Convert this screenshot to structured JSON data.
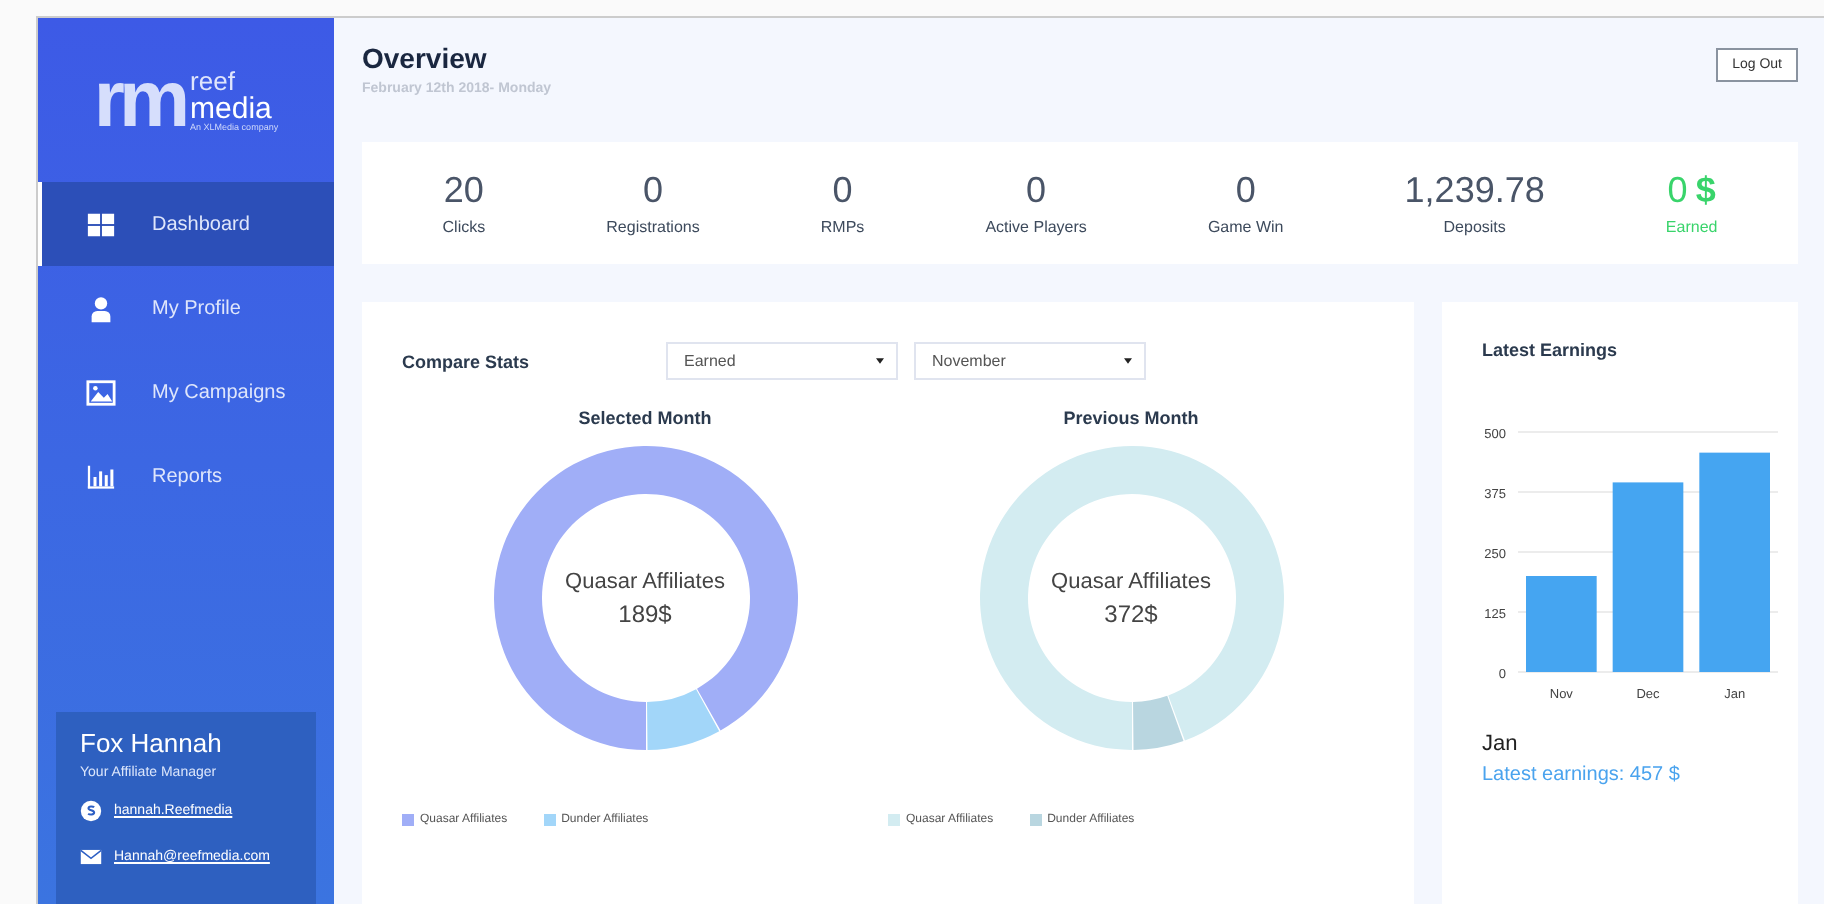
{
  "sidebar": {
    "logo": {
      "mark": "rm",
      "line_1": "reef",
      "line_2": "media",
      "tagline": "An XLMedia company"
    },
    "items": [
      {
        "label": "Dashboard",
        "kind": "grid",
        "selected": true
      },
      {
        "label": "My Profile",
        "kind": "person",
        "selected": false
      },
      {
        "label": "My Campaigns",
        "kind": "image",
        "selected": false
      },
      {
        "label": "Reports",
        "kind": "bars",
        "selected": false
      }
    ],
    "manager": {
      "name": "Fox Hannah",
      "role": "Your Affiliate Manager",
      "links": [
        {
          "kind": "skype",
          "text": "hannah.Reefmedia"
        },
        {
          "kind": "email",
          "text": "Hannah@reefmedia.com"
        }
      ]
    }
  },
  "header": {
    "title": "Overview",
    "date": "February 12th 2018- Monday",
    "logout": "Log Out"
  },
  "stats": [
    {
      "value": "20",
      "label": "Clicks",
      "kind": "plain"
    },
    {
      "value": "0",
      "label": "Registrations",
      "kind": "plain"
    },
    {
      "value": "0",
      "label": "RMPs",
      "kind": "plain"
    },
    {
      "value": "0",
      "label": "Active Players",
      "kind": "plain"
    },
    {
      "value": "0",
      "label": "Game Win",
      "kind": "plain"
    },
    {
      "value": "1,239.78",
      "label": "Deposits",
      "kind": "plain"
    },
    {
      "value": "0",
      "unit": "$",
      "label": "Earned",
      "kind": "money"
    }
  ],
  "compare": {
    "title": "Compare Stats",
    "selects": [
      {
        "value": "Earned"
      },
      {
        "value": "November"
      }
    ],
    "donuts": [
      {
        "title": "Selected Month",
        "center_label": "Quasar Affiliates",
        "center_value": "189$",
        "legend": [
          {
            "label": "Quasar Affiliates",
            "color": "#a0aef7"
          },
          {
            "label": "Dunder Affiliates",
            "color": "#a2d6f9"
          }
        ]
      },
      {
        "title": "Previous Month",
        "center_label": "Quasar Affiliates",
        "center_value": "372$",
        "legend": [
          {
            "label": "Quasar Affiliates",
            "color": "#d3ecf1"
          },
          {
            "label": "Dunder Affiliates",
            "color": "#b9d6e0"
          }
        ]
      }
    ]
  },
  "earnings": {
    "title": "Latest Earnings",
    "chart_data": {
      "type": "bar",
      "categories": [
        "Nov",
        "Dec",
        "Jan"
      ],
      "series": [
        {
          "color": "#45a5f1",
          "values": [
            200,
            395,
            457
          ]
        }
      ],
      "grid": true,
      "ylim": [
        0,
        500
      ],
      "yticks": [
        0,
        125,
        250,
        375,
        500
      ]
    },
    "month": "Jan",
    "summary": "Latest earnings: 457 $"
  }
}
